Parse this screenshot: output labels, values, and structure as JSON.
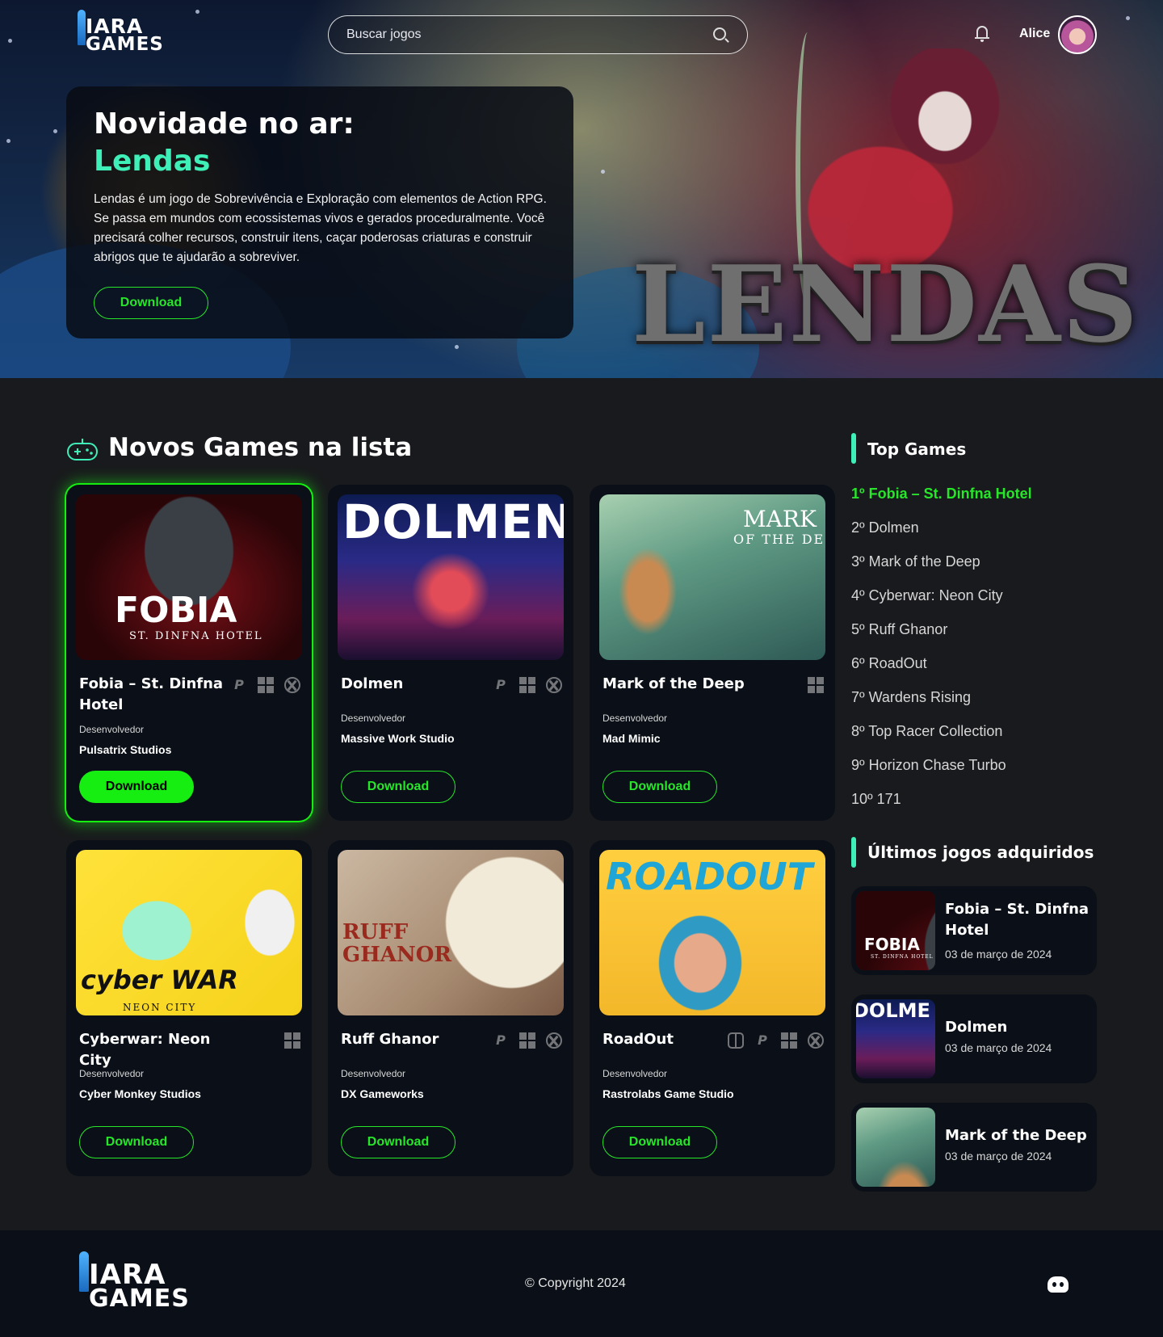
{
  "header": {
    "logo": {
      "line1": "IARA",
      "line2": "GAMES"
    },
    "search": {
      "placeholder": "Buscar jogos"
    },
    "user": {
      "name": "Alice"
    }
  },
  "hero": {
    "title_line1": "Novidade no ar:",
    "title_line2": "Lendas",
    "description": "Lendas é um jogo de Sobrevivência e Exploração com elementos de Action RPG. Se passa em mundos com ecossistemas vivos e gerados proceduralmente. Você precisará colher recursos, construir itens, caçar poderosas criaturas e construir abrigos que te ajudarão a sobreviver.",
    "button": "Download",
    "art_title": "LENDAS"
  },
  "new_games": {
    "title": "Novos Games na lista",
    "dev_label": "Desenvolvedor",
    "download_label": "Download",
    "games": [
      {
        "name": "Fobia – St. Dinfna Hotel",
        "developer": "Pulsatrix Studios",
        "platforms": [
          "playstation-icon",
          "windows-icon",
          "xbox-icon"
        ],
        "art_title": "FOBIA",
        "art_sub": "ST. DINFNA HOTEL"
      },
      {
        "name": "Dolmen",
        "developer": "Massive Work Studio",
        "platforms": [
          "playstation-icon",
          "windows-icon",
          "xbox-icon"
        ],
        "art_title": "DOLMEN"
      },
      {
        "name": "Mark of the Deep",
        "developer": "Mad Mimic",
        "platforms": [
          "windows-icon"
        ],
        "art_title": "MARK",
        "art_sub": "OF THE DEEP"
      },
      {
        "name": "Cyberwar: Neon City",
        "developer": "Cyber Monkey Studios",
        "platforms": [
          "windows-icon"
        ],
        "art_title": "cyber WAR",
        "art_sub": "NEON CITY"
      },
      {
        "name": "Ruff Ghanor",
        "developer": "DX Gameworks",
        "platforms": [
          "playstation-icon",
          "windows-icon",
          "xbox-icon"
        ],
        "art_title": "RUFF GHANOR"
      },
      {
        "name": "RoadOut",
        "developer": "Rastrolabs Game Studio",
        "platforms": [
          "switch-icon",
          "playstation-icon",
          "windows-icon",
          "xbox-icon"
        ],
        "art_title": "ROADOUT"
      }
    ]
  },
  "top_games": {
    "title": "Top Games",
    "items": [
      "1º Fobia – St. Dinfna Hotel",
      "2º Dolmen",
      "3º Mark of the Deep",
      "4º Cyberwar: Neon City",
      "5º Ruff Ghanor",
      "6º RoadOut",
      "7º Wardens Rising",
      "8º Top Racer Collection",
      "9º Horizon Chase Turbo",
      "10º 171"
    ]
  },
  "recent": {
    "title": "Últimos jogos adquiridos",
    "items": [
      {
        "name": "Fobia – St. Dinfna Hotel",
        "date": "03 de março de 2024",
        "art_title": "FOBIA",
        "art_sub": "ST. DINFNA HOTEL"
      },
      {
        "name": "Dolmen",
        "date": "03 de março de 2024",
        "art_title": "DOLME"
      },
      {
        "name": "Mark of the Deep",
        "date": "03 de março de 2024"
      }
    ]
  },
  "footer": {
    "logo": {
      "line1": "IARA",
      "line2": "GAMES"
    },
    "copyright": "© Copyright 2024"
  },
  "colors": {
    "accent_green": "#16ee12",
    "accent_teal": "#3ef0b7",
    "background": "#191a1d",
    "card": "#0b1018"
  }
}
